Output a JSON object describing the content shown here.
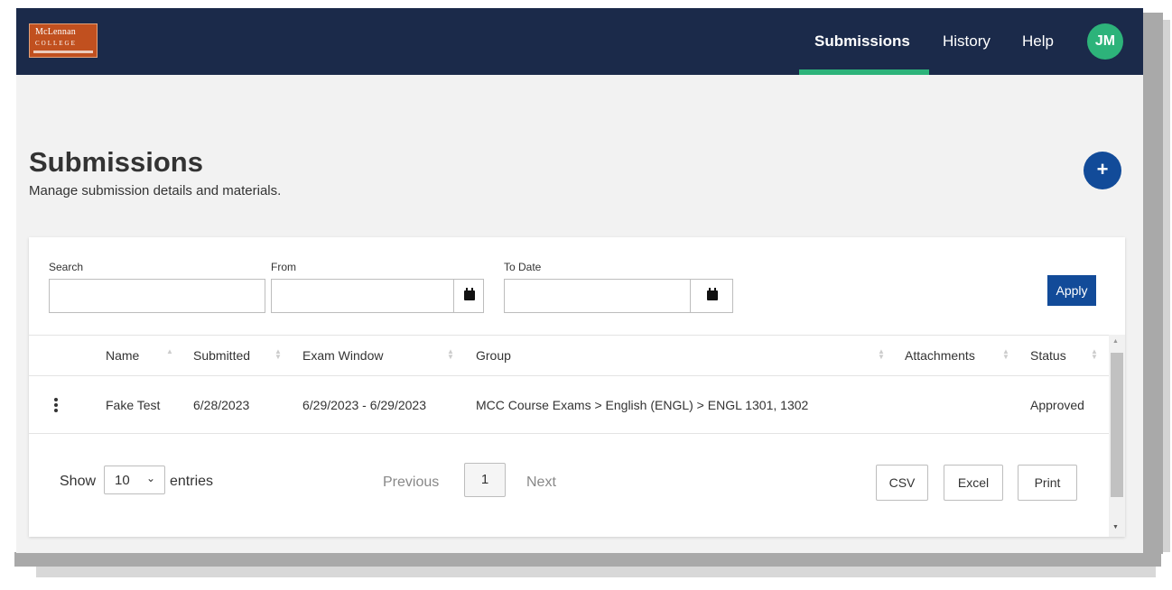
{
  "brand": {
    "logo_line1": "McLennan",
    "logo_line2": "COLLEGE"
  },
  "nav": {
    "items": [
      {
        "label": "Submissions"
      },
      {
        "label": "History"
      },
      {
        "label": "Help"
      }
    ],
    "avatar_initials": "JM"
  },
  "page": {
    "title": "Submissions",
    "subtitle": "Manage submission details and materials.",
    "add_icon": "+"
  },
  "filters": {
    "search_label": "Search",
    "from_label": "From",
    "to_label": "To Date",
    "apply_label": "Apply"
  },
  "table": {
    "columns": [
      "Name",
      "Submitted",
      "Exam Window",
      "Group",
      "Attachments",
      "Status"
    ],
    "rows": [
      {
        "name": "Fake Test",
        "submitted": "6/28/2023",
        "exam_window": "6/29/2023 - 6/29/2023",
        "group": "MCC Course Exams > English (ENGL) > ENGL 1301, 1302",
        "attachments": "",
        "status": "Approved"
      }
    ]
  },
  "pagination": {
    "show_label": "Show",
    "entries_value": "10",
    "entries_label": "entries",
    "previous_label": "Previous",
    "current_page": "1",
    "next_label": "Next"
  },
  "export": {
    "csv_label": "CSV",
    "excel_label": "Excel",
    "print_label": "Print"
  },
  "colors": {
    "navbar": "#1b2a4a",
    "accent_green": "#2db37a",
    "primary_blue": "#124b99",
    "logo_orange": "#c1501f"
  }
}
